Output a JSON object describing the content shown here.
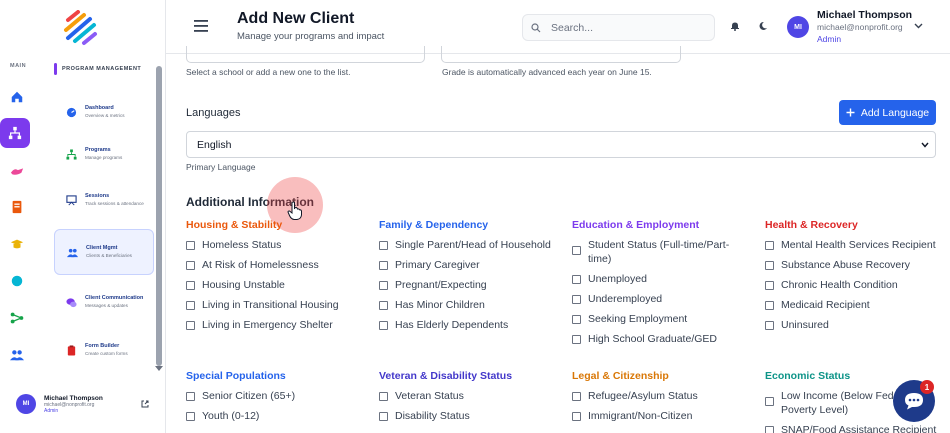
{
  "sidebar": {
    "rail_label": "MAIN",
    "section_label": "PROGRAM MANAGEMENT",
    "items": [
      {
        "title": "Dashboard",
        "subtitle": "Overview & metrics"
      },
      {
        "title": "Programs",
        "subtitle": "Manage programs"
      },
      {
        "title": "Sessions",
        "subtitle": "Track sessions & attendance"
      },
      {
        "title": "Client Mgmt",
        "subtitle": "Clients & Beneficiaries"
      },
      {
        "title": "Client Communication",
        "subtitle": "Messages & updates"
      },
      {
        "title": "Form Builder",
        "subtitle": "Create custom forms"
      }
    ],
    "user": {
      "initials": "MI",
      "name": "Michael Thompson",
      "email": "michael@nonprofit.org",
      "role": "Admin"
    }
  },
  "header": {
    "title": "Add New Client",
    "subtitle": "Manage your programs and impact",
    "search_placeholder": "Search...",
    "user": {
      "initials": "MI",
      "name": "Michael Thompson",
      "email": "michael@nonprofit.org",
      "role": "Admin"
    }
  },
  "form": {
    "school_hint": "Select a school or add a new one to the list.",
    "grade_hint": "Grade is automatically advanced each year on June 15.",
    "languages_label": "Languages",
    "add_language_label": "Add Language",
    "language_value": "English",
    "primary_language_hint": "Primary Language",
    "additional_title": "Additional Information",
    "groups": [
      {
        "title": "Housing & Stability",
        "color": "#ea580c",
        "items": [
          "Homeless Status",
          "At Risk of Homelessness",
          "Housing Unstable",
          "Living in Transitional Housing",
          "Living in Emergency Shelter"
        ]
      },
      {
        "title": "Family & Dependency",
        "color": "#2563eb",
        "items": [
          "Single Parent/Head of Household",
          "Primary Caregiver",
          "Pregnant/Expecting",
          "Has Minor Children",
          "Has Elderly Dependents"
        ]
      },
      {
        "title": "Education & Employment",
        "color": "#7c3aed",
        "items": [
          "Student Status (Full-time/Part-time)",
          "Unemployed",
          "Underemployed",
          "Seeking Employment",
          "High School Graduate/GED"
        ]
      },
      {
        "title": "Health & Recovery",
        "color": "#dc2626",
        "items": [
          "Mental Health Services Recipient",
          "Substance Abuse Recovery",
          "Chronic Health Condition",
          "Medicaid Recipient",
          "Uninsured"
        ]
      },
      {
        "title": "Special Populations",
        "color": "#2563eb",
        "items": [
          "Senior Citizen (65+)",
          "Youth (0-12)"
        ]
      },
      {
        "title": "Veteran & Disability Status",
        "color": "#4338ca",
        "items": [
          "Veteran Status",
          "Disability Status"
        ]
      },
      {
        "title": "Legal & Citizenship",
        "color": "#d97706",
        "items": [
          "Refugee/Asylum Status",
          "Immigrant/Non-Citizen"
        ]
      },
      {
        "title": "Economic Status",
        "color": "#0d9488",
        "items": [
          "Low Income (Below Federal Poverty Level)",
          "SNAP/Food Assistance Recipient"
        ]
      }
    ]
  },
  "chat": {
    "badge": "1"
  }
}
